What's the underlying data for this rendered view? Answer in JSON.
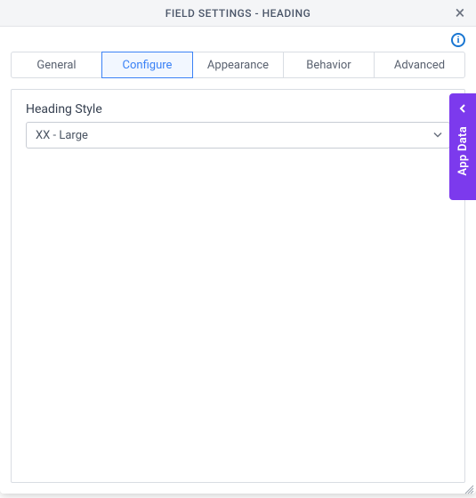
{
  "header": {
    "title": "FIELD SETTINGS - HEADING"
  },
  "tabs": [
    {
      "label": "General"
    },
    {
      "label": "Configure"
    },
    {
      "label": "Appearance"
    },
    {
      "label": "Behavior"
    },
    {
      "label": "Advanced"
    }
  ],
  "active_tab_index": 1,
  "form": {
    "heading_style_label": "Heading Style",
    "heading_style_value": "XX - Large"
  },
  "side_panel": {
    "label": "App Data"
  },
  "icons": {
    "close": "×",
    "info": "i"
  },
  "colors": {
    "accent": "#3b82f6",
    "side_panel": "#7c3aed"
  }
}
